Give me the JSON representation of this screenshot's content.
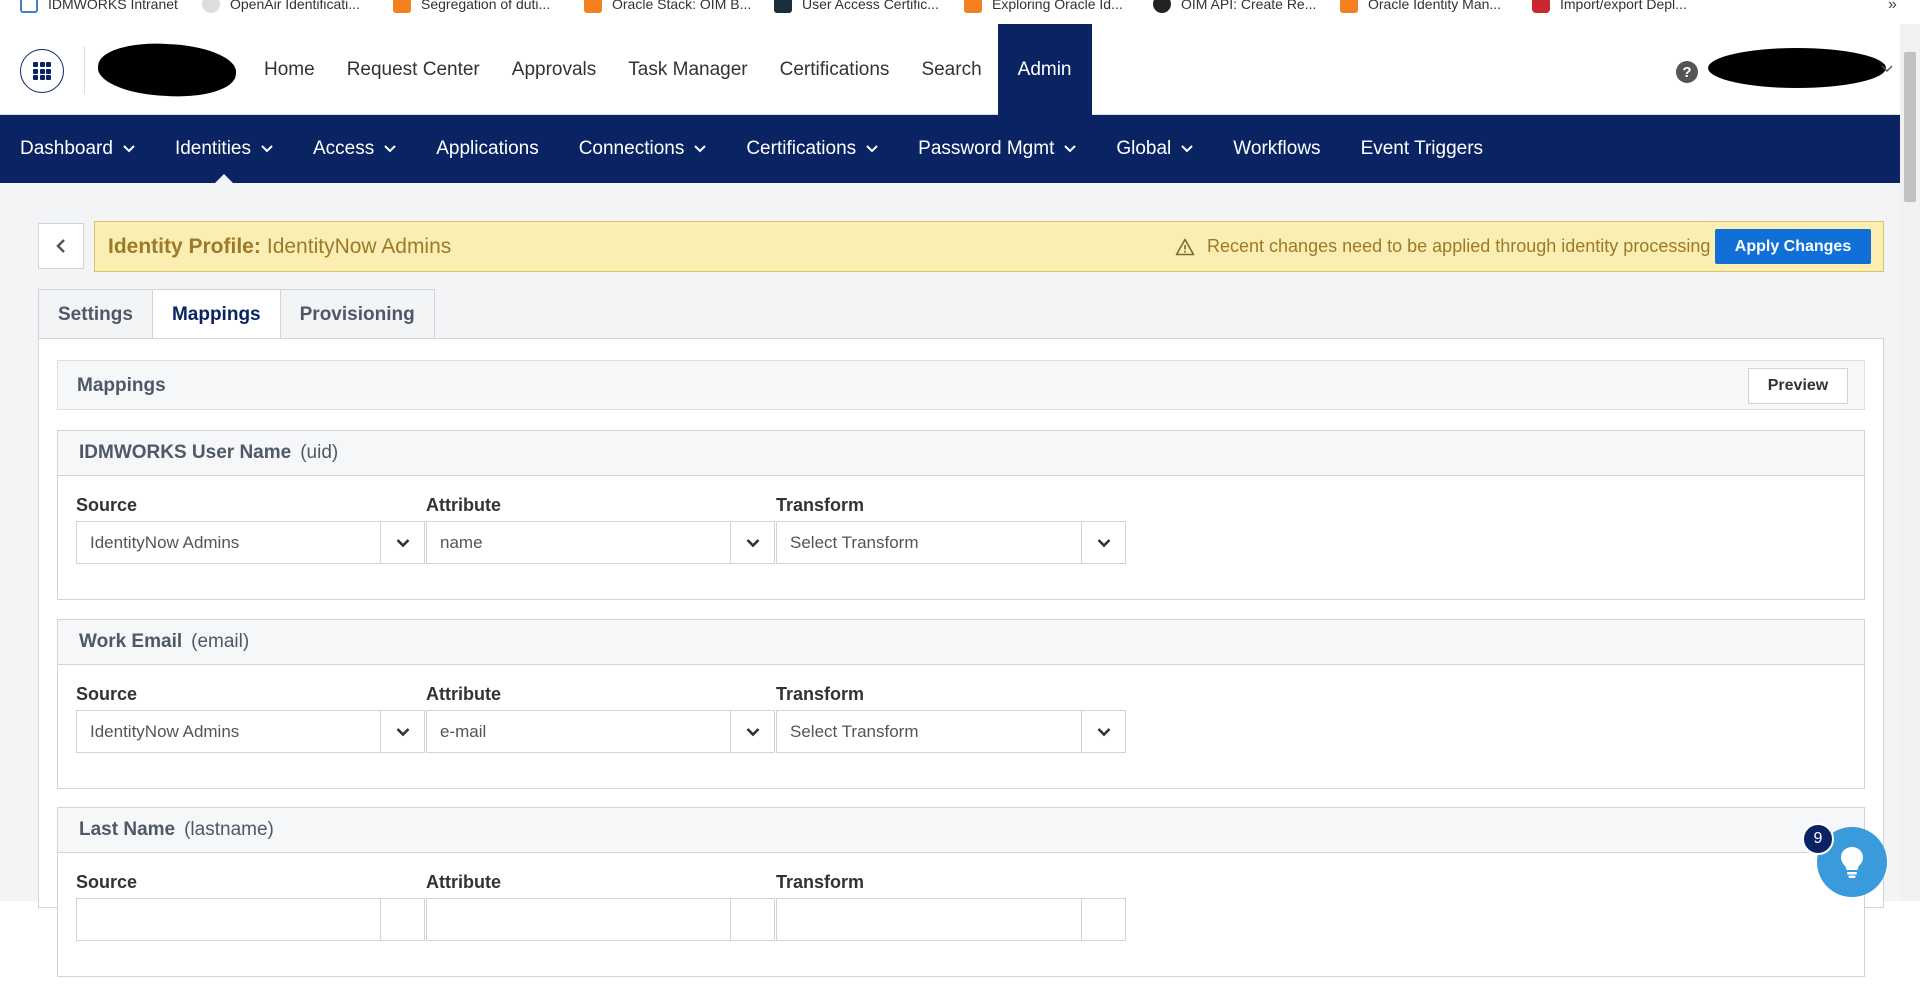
{
  "bookmarks": [
    {
      "label": "IDMWORKS Intranet"
    },
    {
      "label": "OpenAir Identificati..."
    },
    {
      "label": "Segregation of duti..."
    },
    {
      "label": "Oracle Stack: OIM B..."
    },
    {
      "label": "User Access Certific..."
    },
    {
      "label": "Exploring Oracle Id..."
    },
    {
      "label": "OIM API: Create Re..."
    },
    {
      "label": "Oracle Identity Man..."
    },
    {
      "label": "Import/export Depl..."
    }
  ],
  "bookmarks_more": "»",
  "topnav": {
    "items": [
      {
        "label": "Home"
      },
      {
        "label": "Request Center"
      },
      {
        "label": "Approvals"
      },
      {
        "label": "Task Manager"
      },
      {
        "label": "Certifications"
      },
      {
        "label": "Search"
      },
      {
        "label": "Admin"
      }
    ],
    "help": "?"
  },
  "adminbar": {
    "items": [
      {
        "label": "Dashboard"
      },
      {
        "label": "Identities"
      },
      {
        "label": "Access"
      },
      {
        "label": "Applications"
      },
      {
        "label": "Connections"
      },
      {
        "label": "Certifications"
      },
      {
        "label": "Password Mgmt"
      },
      {
        "label": "Global"
      },
      {
        "label": "Workflows"
      },
      {
        "label": "Event Triggers"
      }
    ]
  },
  "profile": {
    "label": "Identity Profile:",
    "name": "IdentityNow Admins",
    "warning": "Recent changes need to be applied through identity processing",
    "apply_label": "Apply Changes"
  },
  "tabs": [
    {
      "label": "Settings"
    },
    {
      "label": "Mappings"
    },
    {
      "label": "Provisioning"
    }
  ],
  "mappings": {
    "title": "Mappings",
    "preview_label": "Preview",
    "field_labels": {
      "source": "Source",
      "attribute": "Attribute",
      "transform": "Transform"
    },
    "items": [
      {
        "name": "IDMWORKS User Name",
        "key": "(uid)",
        "source": "IdentityNow Admins",
        "attribute": "name",
        "transform_placeholder": "Select Transform"
      },
      {
        "name": "Work Email",
        "key": "(email)",
        "source": "IdentityNow Admins",
        "attribute": "e-mail",
        "transform_placeholder": "Select Transform"
      },
      {
        "name": "Last Name",
        "key": "(lastname)",
        "source": "",
        "attribute": "",
        "transform_placeholder": ""
      }
    ]
  },
  "tips_badge": "9",
  "colors": {
    "brand_navy": "#0a2463",
    "apply_blue": "#1070d8",
    "banner_yellow": "#fbeeb3",
    "tips_blue": "#3a9bdc"
  }
}
